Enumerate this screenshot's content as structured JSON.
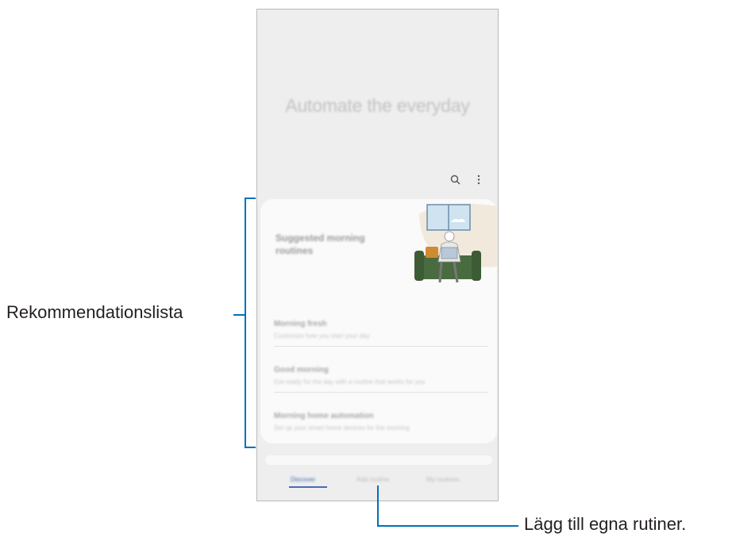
{
  "screen": {
    "hero_title": "Automate the everyday",
    "top_actions": [
      {
        "icon": "search-icon"
      },
      {
        "icon": "more-vert-icon"
      }
    ],
    "card": {
      "title": "Suggested morning routines",
      "items": [
        {
          "title": "Morning fresh",
          "subtitle": "Customize how you start your day"
        },
        {
          "title": "Good morning",
          "subtitle": "Get ready for the day with a routine that works for you"
        },
        {
          "title": "Morning home automation",
          "subtitle": "Set up your smart home devices for the morning"
        }
      ]
    },
    "tabs": [
      {
        "label": "Discover"
      },
      {
        "label": "Add routine"
      },
      {
        "label": "My routines"
      }
    ],
    "active_tab": 0,
    "accent_color": "#4b6bb3"
  },
  "callouts": {
    "recommendation_label": "Rekommendationslista",
    "add_routine_label": "Lägg till egna rutiner.",
    "line_color": "#0070b8"
  }
}
